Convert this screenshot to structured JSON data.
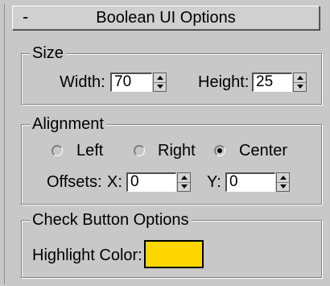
{
  "rollout": {
    "collapse_symbol": "-",
    "title": "Boolean UI Options"
  },
  "size": {
    "title": "Size",
    "width_label": "Width:",
    "width_value": "70",
    "height_label": "Height:",
    "height_value": "25"
  },
  "alignment": {
    "title": "Alignment",
    "options": [
      "Left",
      "Right",
      "Center"
    ],
    "selected": "Center",
    "offsets_label": "Offsets:",
    "x_label": "X:",
    "x_value": "0",
    "y_label": "Y:",
    "y_value": "0"
  },
  "check_button_options": {
    "title": "Check Button Options",
    "highlight_label": "Highlight Color:",
    "highlight_color": "#ffd700"
  }
}
